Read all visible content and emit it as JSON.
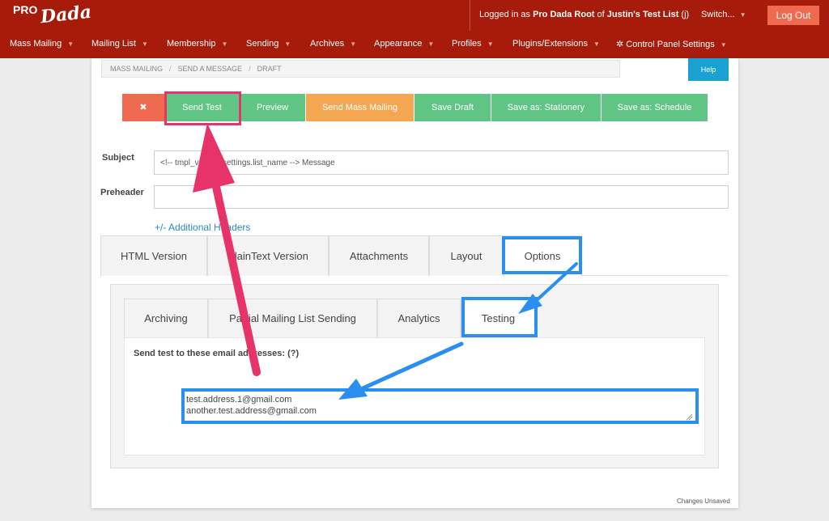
{
  "header": {
    "logo_pro": "PRO",
    "logo_dada": "Dada",
    "logged_prefix": "Logged in as ",
    "logged_user": "Pro Dada Root",
    "logged_mid": " of ",
    "logged_list": "Justin's Test List",
    "logged_suffix": " (j)",
    "switch_label": "Switch...",
    "logout_label": "Log Out",
    "caret": "▼"
  },
  "nav": {
    "items": [
      {
        "label": "Mass Mailing"
      },
      {
        "label": "Mailing List"
      },
      {
        "label": "Membership"
      },
      {
        "label": "Sending"
      },
      {
        "label": "Archives"
      },
      {
        "label": "Appearance"
      },
      {
        "label": "Profiles"
      },
      {
        "label": "Plugins/Extensions"
      },
      {
        "label": "✲ Control Panel Settings"
      }
    ]
  },
  "breadcrumb": [
    "MASS MAILING",
    "SEND A MESSAGE",
    "DRAFT"
  ],
  "breadcrumb_sep": "/",
  "help_label": "Help",
  "toolbar": {
    "delete_label": "✖",
    "send_test_label": "Send Test",
    "preview_label": "Preview",
    "send_mass_label": "Send Mass Mailing",
    "save_draft_label": "Save Draft",
    "save_stationery_label": "Save as: Stationery",
    "save_schedule_label": "Save as: Schedule"
  },
  "form": {
    "subject_label": "Subject",
    "subject_value": "<!-- tmpl_var list_settings.list_name --> Message",
    "preheader_label": "Preheader",
    "preheader_value": "",
    "additional_headers_label": "+/- Additional Headers"
  },
  "tabs": [
    {
      "label": "HTML Version"
    },
    {
      "label": "PlainText Version"
    },
    {
      "label": "Attachments"
    },
    {
      "label": "Layout"
    },
    {
      "label": "Options"
    }
  ],
  "options_tabs": [
    {
      "label": "Archiving"
    },
    {
      "label": "Partial Mailing List Sending"
    },
    {
      "label": "Analytics"
    },
    {
      "label": "Testing"
    }
  ],
  "testing": {
    "label": "Send test to these email addresses: (?)",
    "emails": [
      "test.address.1@gmail.com",
      "another.test.address@gmail.com"
    ]
  },
  "status_text": "Changes Unsaved",
  "colors": {
    "header_bg": "#a61b0a",
    "accent_green": "#60c484",
    "accent_orange": "#f4a651",
    "accent_red": "#ef6b50",
    "help_blue": "#1aa1d2",
    "annotation_pink": "#e8336a",
    "annotation_blue": "#2b8ff0"
  }
}
